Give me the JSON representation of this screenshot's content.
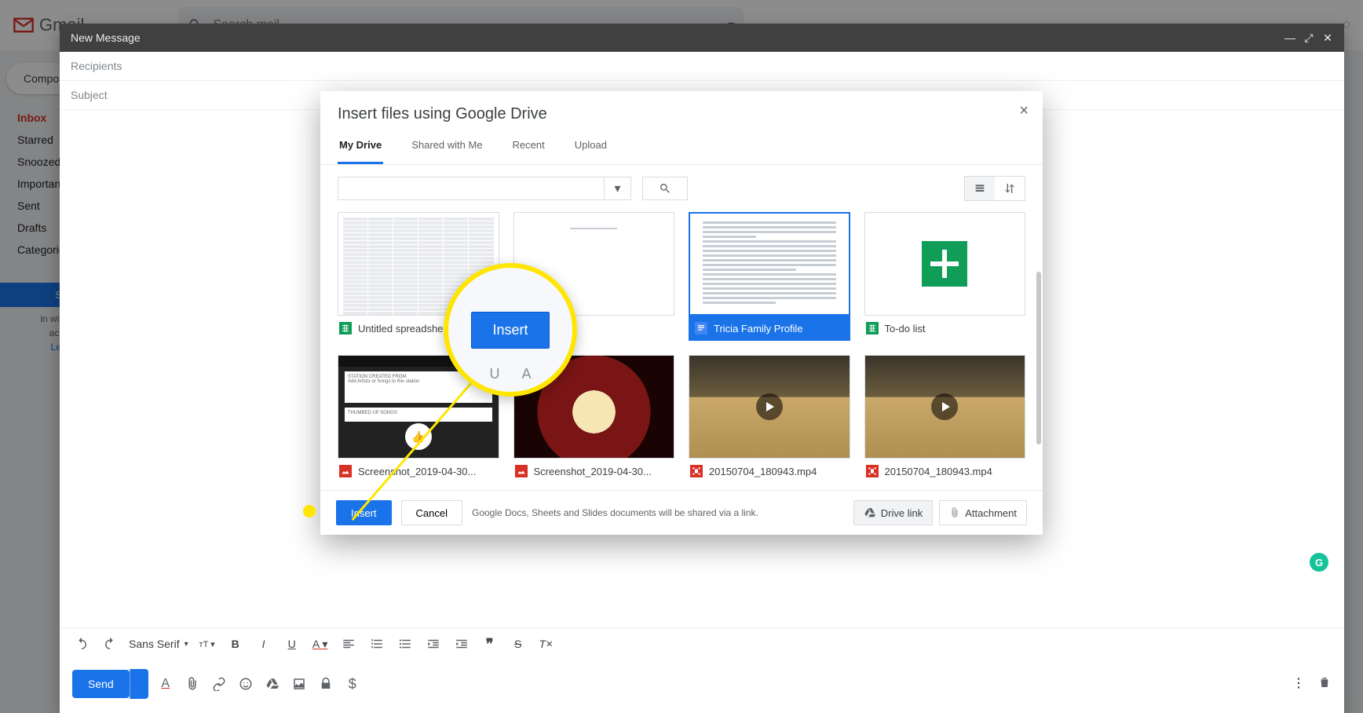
{
  "gmail": {
    "brand": "Gmail",
    "search_placeholder": "Search mail",
    "compose": "Compose",
    "sidebar": [
      "Inbox",
      "Starred",
      "Snoozed",
      "Important",
      "Sent",
      "Drafts",
      "Categories"
    ],
    "signin": "Sign in",
    "signin_sub1": "in will sign you",
    "signin_sub2": "across Go",
    "signin_learn": "Learn mo"
  },
  "compose": {
    "title": "New Message",
    "recipients": "Recipients",
    "subject": "Subject",
    "font": "Sans Serif",
    "send": "Send"
  },
  "picker": {
    "title": "Insert files using Google Drive",
    "tabs": [
      "My Drive",
      "Shared with Me",
      "Recent",
      "Upload"
    ],
    "active_tab": 0,
    "footer_note": "Google Docs, Sheets and Slides documents will be shared via a link.",
    "insert": "Insert",
    "cancel": "Cancel",
    "drive_link": "Drive link",
    "attachment": "Attachment",
    "files": [
      {
        "name": "Untitled spreadsheet",
        "type": "sheets"
      },
      {
        "name": "U",
        "type": "sheets"
      },
      {
        "name": "Tricia Family Profile",
        "type": "docs",
        "selected": true
      },
      {
        "name": "To-do list",
        "type": "sheets"
      },
      {
        "name": "Screenshot_2019-04-30...",
        "type": "image"
      },
      {
        "name": "Screenshot_2019-04-30...",
        "type": "image"
      },
      {
        "name": "20150704_180943.mp4",
        "type": "video"
      },
      {
        "name": "20150704_180943.mp4",
        "type": "video"
      }
    ]
  },
  "callout": {
    "button": "Insert",
    "mini_left": "U",
    "mini_right": "A"
  }
}
